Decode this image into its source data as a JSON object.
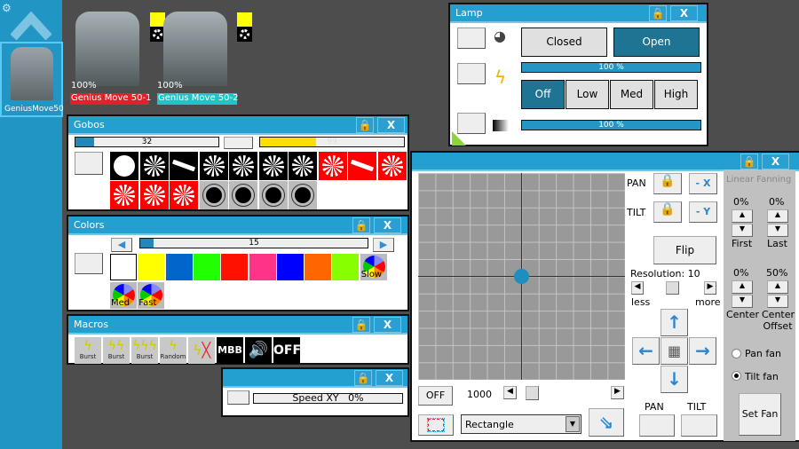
{
  "sidebar": {
    "gear_icon": "gear-icon",
    "up_icon": "chevron-up-icon",
    "fixture_label": "GeniusMove50"
  },
  "fixtures": [
    {
      "intensity": "100%",
      "name": "Genius Move 50-1",
      "label_color": "#e0202c",
      "swatch_color": "#ffff00"
    },
    {
      "intensity": "100%",
      "name": "Genius Move 50-2",
      "label_color": "#1fc4c4",
      "swatch_color": "#ffff00"
    }
  ],
  "gobos": {
    "title": "Gobos",
    "slider_value": "32",
    "slider_fraction": 0.125,
    "yellow_value": "99",
    "yellow_fraction": 0.39,
    "items": [
      "open",
      "spiral",
      "line",
      "split-spiral",
      "flower",
      "shard",
      "stars",
      "spiral-red",
      "line-red",
      "split-spiral-red",
      "flower-red",
      "shard-red",
      "stars-red",
      "rotate-cw",
      "rotate-ccw-1",
      "rotate-ccw-2",
      "rotate-cw-2"
    ]
  },
  "colors": {
    "title": "Colors",
    "slider_value": "15",
    "slider_fraction": 0.06,
    "swatches": [
      "#ffffff",
      "#ffff00",
      "#0066cc",
      "#22ff00",
      "#ff1100",
      "#ff3388",
      "#0000ff",
      "#ff6600",
      "#88ff00"
    ],
    "wheels": [
      "Slow",
      "Med",
      "Fast"
    ]
  },
  "macros": {
    "title": "Macros",
    "items": [
      "Burst",
      "Burst",
      "Burst",
      "Random"
    ],
    "mbb": "MBB",
    "off": "OFF"
  },
  "speed": {
    "label": "Speed XY",
    "value": "0%"
  },
  "lamp": {
    "title": "Lamp",
    "closed": "Closed",
    "open": "Open",
    "power1": "100 %",
    "off": "Off",
    "low": "Low",
    "med": "Med",
    "high": "High",
    "power2": "100 %",
    "power_fraction": 1.0
  },
  "xy": {
    "pan": "PAN",
    "tilt": "TILT",
    "minus_x": "- X",
    "minus_y": "- Y",
    "flip": "Flip",
    "resolution": "Resolution: 10",
    "less": "less",
    "more": "more",
    "off": "OFF",
    "speed_value": "1000",
    "shape": "Rectangle",
    "pan_bottom": "PAN",
    "tilt_bottom": "TILT",
    "fanning": {
      "title": "Linear Fanning",
      "first_value": "0%",
      "last_value": "0%",
      "first": "First",
      "last": "Last",
      "center_value": "0%",
      "offset_value": "50%",
      "center": "Center",
      "center_offset": "Center Offset",
      "pan_fan": "Pan fan",
      "tilt_fan": "Tilt fan",
      "set_fan": "Set Fan"
    }
  }
}
